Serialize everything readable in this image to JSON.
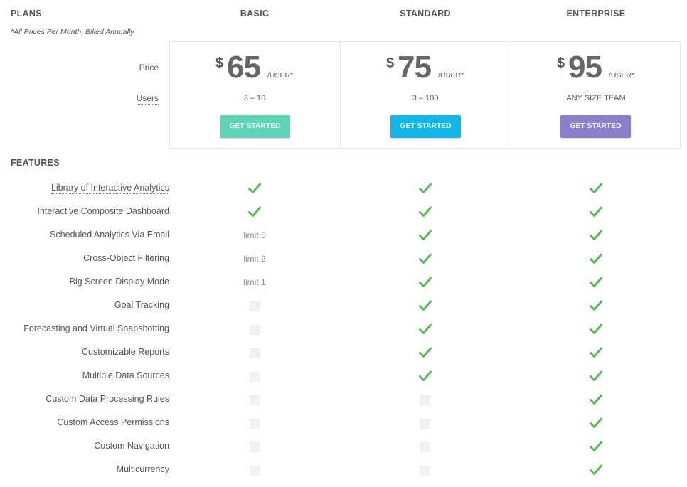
{
  "header": {
    "plans_title": "PLANS",
    "note": "*All Prices Per Month, Billed Annually",
    "price_label": "Price",
    "users_label": "Users",
    "features_title": "FEATURES"
  },
  "plans": [
    {
      "name": "BASIC",
      "currency": "$",
      "price": "65",
      "per": "/USER*",
      "users": "3 – 10",
      "button": "GET STARTED",
      "button_color": "#5fd3b6"
    },
    {
      "name": "STANDARD",
      "currency": "$",
      "price": "75",
      "per": "/USER*",
      "users": "3 – 100",
      "button": "GET STARTED",
      "button_color": "#13b6e8"
    },
    {
      "name": "ENTERPRISE",
      "currency": "$",
      "price": "95",
      "per": "/USER*",
      "users": "ANY SIZE TEAM",
      "button": "GET STARTED",
      "button_color": "#8b7fcb"
    }
  ],
  "features": [
    {
      "label": "Library of Interactive Analytics",
      "dotted": true,
      "values": [
        "check",
        "check",
        "check"
      ]
    },
    {
      "label": "Interactive Composite Dashboard",
      "values": [
        "check",
        "check",
        "check"
      ]
    },
    {
      "label": "Scheduled Analytics Via Email",
      "values": [
        "limit 5",
        "check",
        "check"
      ]
    },
    {
      "label": "Cross-Object Filtering",
      "values": [
        "limit 2",
        "check",
        "check"
      ]
    },
    {
      "label": "Big Screen Display Mode",
      "values": [
        "limit 1",
        "check",
        "check"
      ]
    },
    {
      "label": "Goal Tracking",
      "values": [
        "none",
        "check",
        "check"
      ]
    },
    {
      "label": "Forecasting and Virtual Snapshotting",
      "values": [
        "none",
        "check",
        "check"
      ]
    },
    {
      "label": "Customizable Reports",
      "values": [
        "none",
        "check",
        "check"
      ]
    },
    {
      "label": "Multiple Data Sources",
      "values": [
        "none",
        "check",
        "check"
      ]
    },
    {
      "label": "Custom Data Processing Rules",
      "values": [
        "none",
        "none",
        "check"
      ]
    },
    {
      "label": "Custom Access Permissions",
      "values": [
        "none",
        "none",
        "check"
      ]
    },
    {
      "label": "Custom Navigation",
      "values": [
        "none",
        "none",
        "check"
      ]
    },
    {
      "label": "Multicurrency",
      "values": [
        "none",
        "none",
        "check"
      ]
    }
  ],
  "colors": {
    "check": "#5cb85c",
    "text": "#555555",
    "border": "#e6e6e6"
  },
  "icons": {
    "included": "checkmark-icon",
    "not_included": "empty-box-icon"
  }
}
